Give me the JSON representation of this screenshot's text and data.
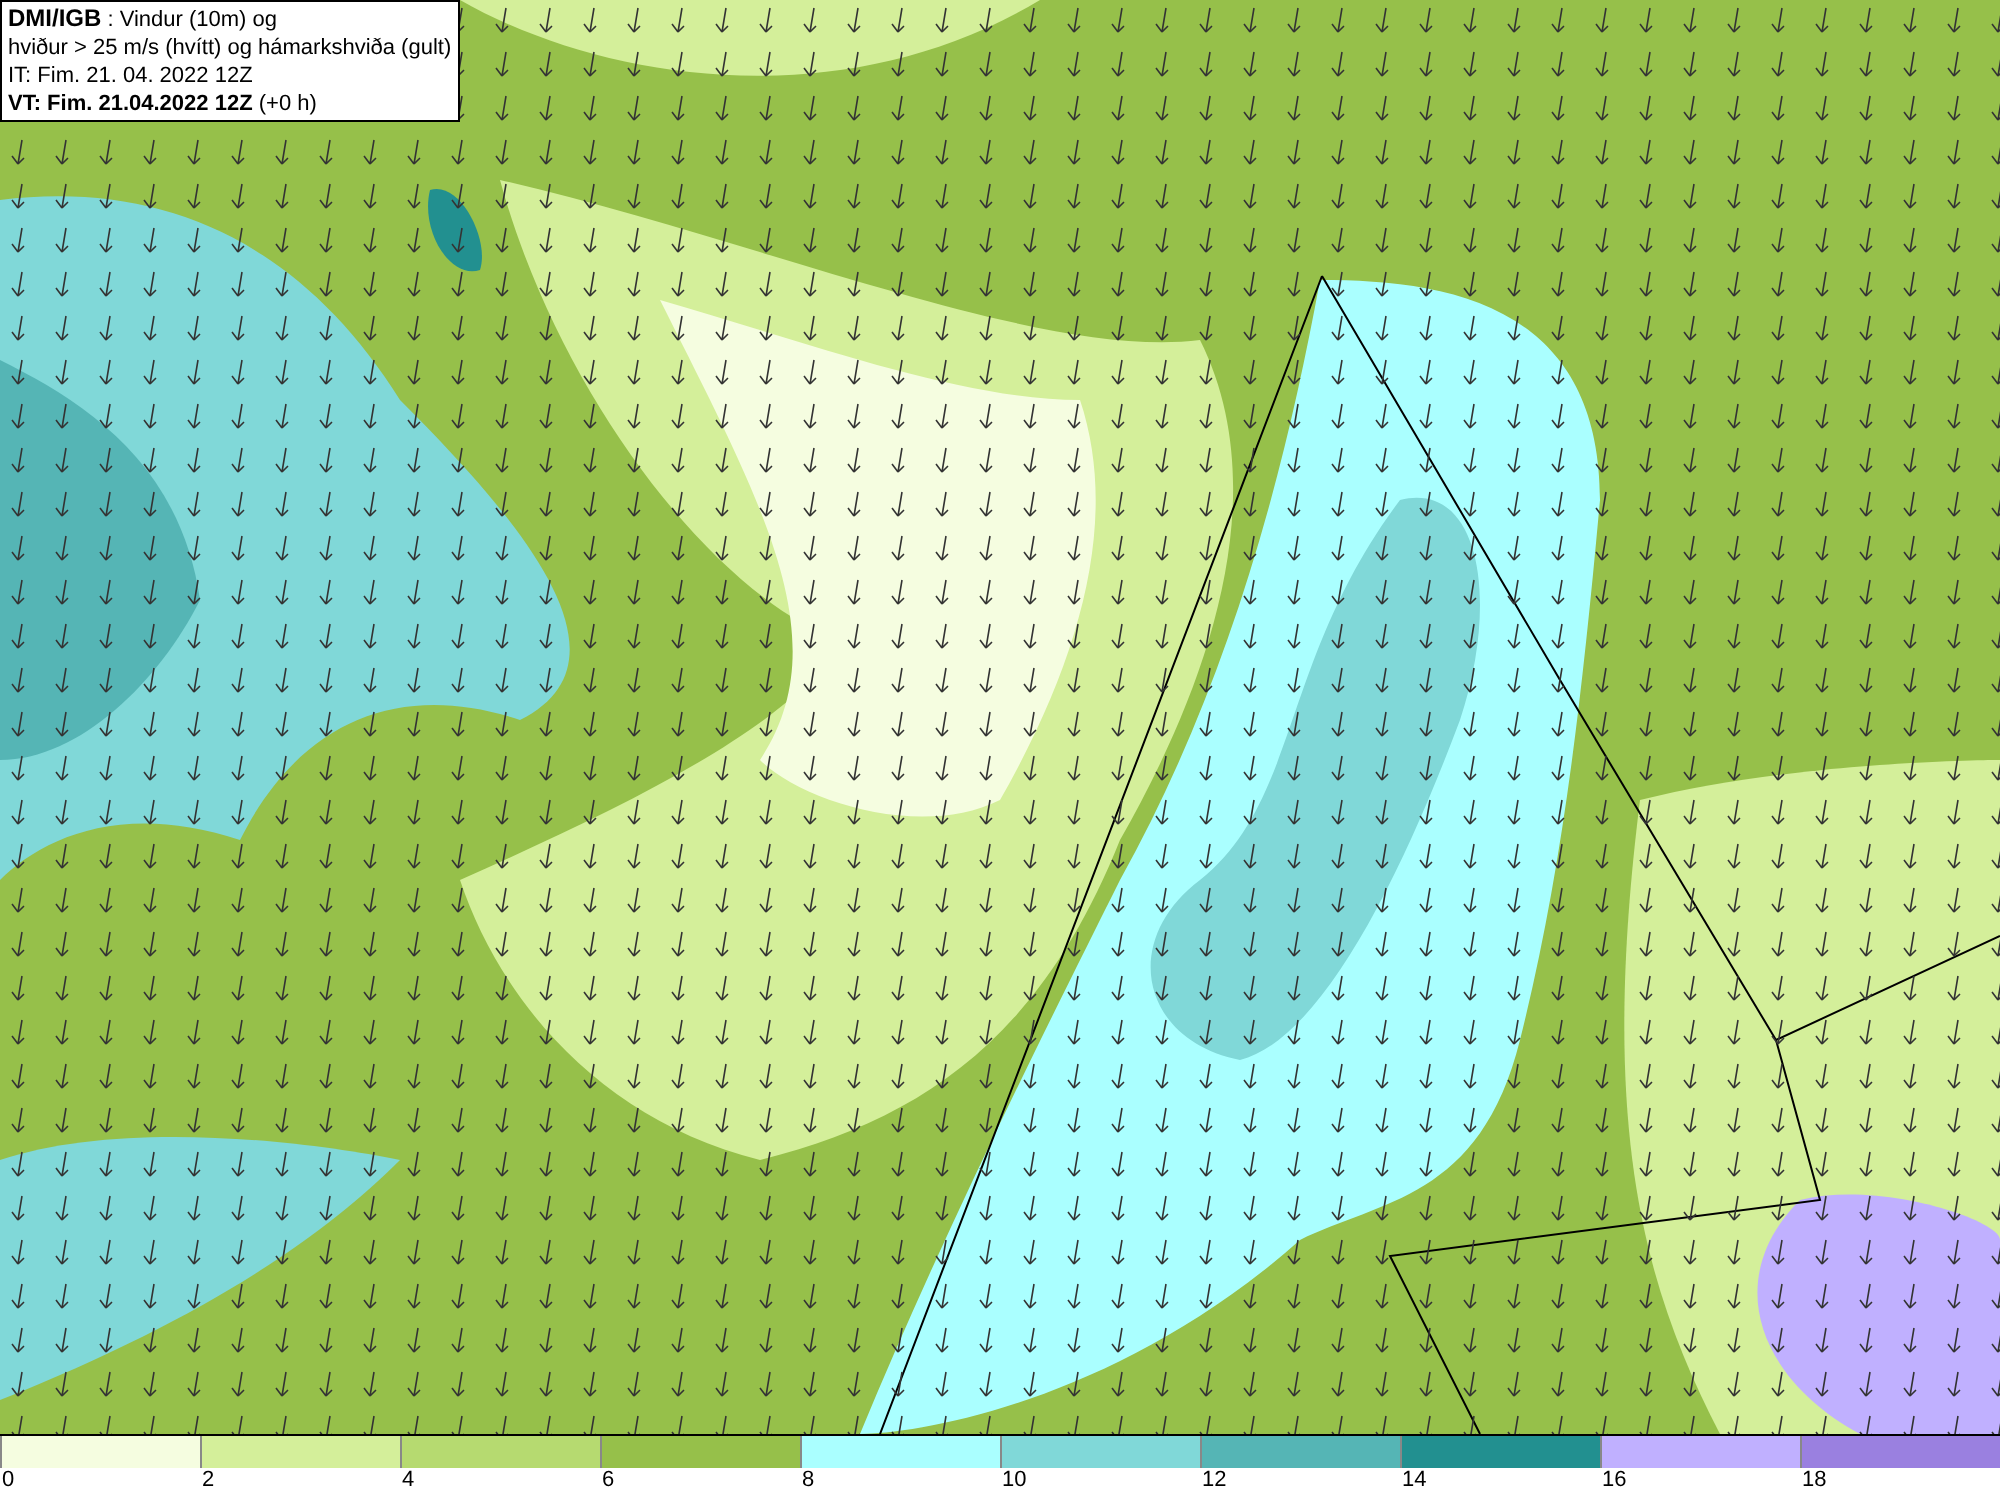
{
  "header": {
    "source": "DMI/IGB",
    "title_rest": " : Vindur (10m) og",
    "line2": "hviður > 25 m/s (hvítt) og hámarkshviða (gult)",
    "init_time": "IT: Fim. 21. 04. 2022 12Z",
    "valid_time": "VT: Fim. 21.04.2022 12Z",
    "offset": " (+0 h)"
  },
  "legend": [
    {
      "label": "0",
      "color": "#f5fde0"
    },
    {
      "label": "2",
      "color": "#d4ef9a"
    },
    {
      "label": "4",
      "color": "#b6da70"
    },
    {
      "label": "6",
      "color": "#96c04a"
    },
    {
      "label": "8",
      "color": "#aaffff"
    },
    {
      "label": "10",
      "color": "#80d8d8"
    },
    {
      "label": "12",
      "color": "#55b5b5"
    },
    {
      "label": "14",
      "color": "#229090"
    },
    {
      "label": "16",
      "color": "#c0b0ff"
    },
    {
      "label": "18",
      "color": "#9a80e0"
    }
  ]
}
